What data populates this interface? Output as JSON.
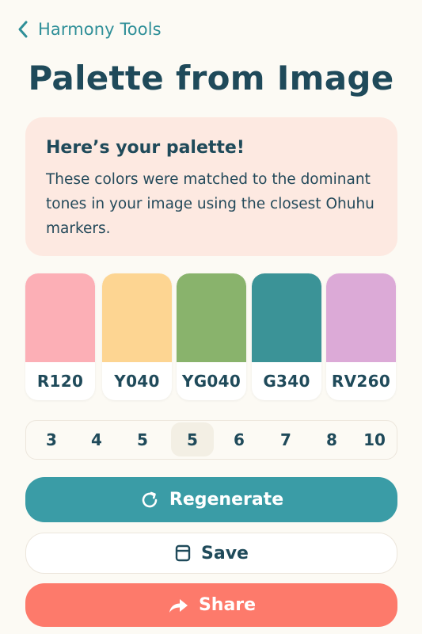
{
  "nav": {
    "back_label": "Harmony Tools"
  },
  "page": {
    "title": "Palette from Image"
  },
  "result_card": {
    "title": "Here’s your palette!",
    "body": "These colors were matched to the dominant tones in your image using the closest Ohuhu markers."
  },
  "swatches": [
    {
      "code": "R120",
      "color": "#fcafb6"
    },
    {
      "code": "Y040",
      "color": "#fdd592"
    },
    {
      "code": "YG040",
      "color": "#89b36c"
    },
    {
      "code": "G340",
      "color": "#3b9397"
    },
    {
      "code": "RV260",
      "color": "#dcaad7"
    }
  ],
  "color_count": {
    "options": [
      "3",
      "4",
      "5",
      "5",
      "6",
      "7",
      "8",
      "10"
    ],
    "selected_index": 3
  },
  "actions": {
    "regenerate_label": "Regenerate",
    "save_label": "Save",
    "share_label": "Share"
  },
  "theme": {
    "primary": "#3a9ca6",
    "share": "#fd7a6b",
    "card_bg": "#fde9e1",
    "text": "#1f4a5a",
    "background": "#fcfaf4"
  },
  "icons": {
    "back": "chevron-left-icon",
    "regenerate": "refresh-icon",
    "save": "save-icon",
    "share": "share-arrow-icon"
  }
}
